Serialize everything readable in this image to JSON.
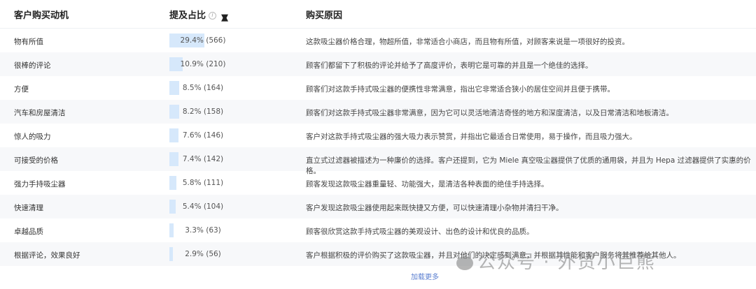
{
  "header": {
    "col1": "客户购买动机",
    "col2": "提及占比",
    "col3": "购买原因",
    "info_icon": "i",
    "sort_icon": "sort-arrows"
  },
  "rows": [
    {
      "motive": "物有所值",
      "percent": 29.4,
      "label": "29.4% (566)",
      "reason": "这款吸尘器价格合理，物超所值，非常适合小商店，而且物有所值，对顾客来说是一项很好的投资。"
    },
    {
      "motive": "很棒的评论",
      "percent": 10.9,
      "label": "10.9% (210)",
      "reason": "顾客们都留下了积极的评论并给予了高度评价，表明它是可靠的并且是一个绝佳的选择。"
    },
    {
      "motive": "方便",
      "percent": 8.5,
      "label": "8.5% (164)",
      "reason": "顾客们对这款手持式吸尘器的便携性非常满意，指出它非常适合狭小的居住空间并且便于携带。"
    },
    {
      "motive": "汽车和房屋清洁",
      "percent": 8.2,
      "label": "8.2% (158)",
      "reason": "顾客们对这款手持式吸尘器非常满意，因为它可以灵活地清洁奇怪的地方和深度清洁，以及日常清洁和地板清洁。"
    },
    {
      "motive": "惊人的吸力",
      "percent": 7.6,
      "label": "7.6% (146)",
      "reason": "客户对这款手持式吸尘器的强大吸力表示赞赏，并指出它最适合日常使用，易于操作，而且吸力强大。"
    },
    {
      "motive": "可接受的价格",
      "percent": 7.4,
      "label": "7.4% (142)",
      "reason": "直立式过滤器被描述为一种廉价的选择。客户还提到，它为 Miele 真空吸尘器提供了优质的通用袋，并且为 Hepa 过滤器提供了实惠的价格。"
    },
    {
      "motive": "强力手持吸尘器",
      "percent": 5.8,
      "label": "5.8% (111)",
      "reason": "顾客发现这款吸尘器重量轻、功能强大，是清洁各种表面的绝佳手持选择。"
    },
    {
      "motive": "快速清理",
      "percent": 5.4,
      "label": "5.4% (104)",
      "reason": "客户发现这款吸尘器使用起来既快捷又方便，可以快速清理小杂物并清扫干净。"
    },
    {
      "motive": "卓越品质",
      "percent": 3.3,
      "label": "3.3% (63)",
      "reason": "顾客很欣赏这款手持式吸尘器的美观设计、出色的设计和优良的品质。"
    },
    {
      "motive": "根据评论，效果良好",
      "percent": 2.9,
      "label": "2.9% (56)",
      "reason": "客户根据积极的评价购买了这款吸尘器，并且对他们的决定感到满意，并根据其性能和客户服务将其推荐给其他人。"
    }
  ],
  "load_more": "加载更多",
  "watermark": "公众号 · 外贸小巨熊",
  "colors": {
    "bar": "#d6e8fb",
    "link": "#5b7fd0"
  }
}
